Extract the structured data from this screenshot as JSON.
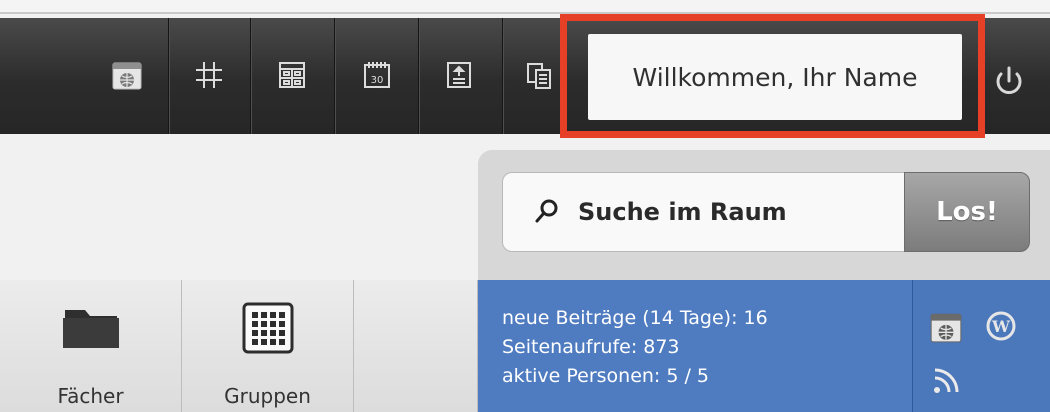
{
  "toolbar": {
    "icons": [
      "calendar-globe-icon",
      "grid-icon",
      "table-icon",
      "calendar-icon",
      "upload-list-icon",
      "copy-document-icon"
    ],
    "welcome_text": "Willkommen, Ihr Name",
    "power": "power-icon"
  },
  "search": {
    "label": "Suche im Raum",
    "button_label": "Los!"
  },
  "tiles": [
    {
      "label": "Fächer",
      "icon": "folder-icon"
    },
    {
      "label": "Gruppen",
      "icon": "group-grid-icon"
    },
    {
      "label": "",
      "icon": ""
    }
  ],
  "stats": {
    "new_posts": "neue Beiträge (14 Tage): 16",
    "page_views": "Seitenaufrufe: 873",
    "active_people": "aktive Personen: 5 / 5"
  },
  "side_icons": [
    "calendar-globe-icon",
    "wordpress-icon",
    "rss-icon"
  ],
  "colors": {
    "highlight": "#e64127",
    "stats_bg": "#4f7cc0"
  }
}
